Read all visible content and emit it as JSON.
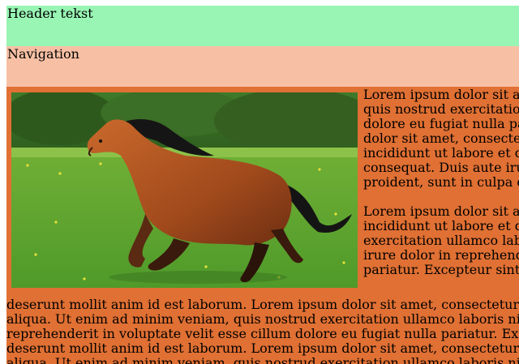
{
  "header": {
    "text": "Header tekst"
  },
  "navigation": {
    "text": "Navigation"
  },
  "main": {
    "image_alt": "horse-photo",
    "side_paragraph_1": [
      "Lorem ipsum dolor sit amet, c",
      "quis nostrud exercitation ullan",
      "dolore eu fugiat nulla pariatur.",
      "dolor sit amet, consectetur adi",
      "incididunt ut labore et dolore r",
      "consequat. Duis aute irure dolo",
      "proident, sunt in culpa qui offi"
    ],
    "side_paragraph_2": [
      "Lorem ipsum dolor sit amet, c",
      "incididunt ut labore et dolore r",
      "exercitation ullamco laboris ni",
      "irure dolor in reprehenderit in",
      "pariatur. Excepteur sint occaec"
    ],
    "bottom_lines": [
      "deserunt mollit anim id est laborum. Lorem ipsum dolor sit amet, consectetur adipiscing elit, sed do",
      "aliqua. Ut enim ad minim veniam, quis nostrud exercitation ullamco laboris nisi ut aliquip ex ea co",
      "reprehenderit in voluptate velit esse cillum dolore eu fugiat nulla pariatur. Excepteur sint occaecat c",
      "deserunt mollit anim id est laborum. Lorem ipsum dolor sit amet, consectetur adipiscing elit, sed do",
      "aliqua. Ut enim ad minim veniam, quis nostrud exercitation ullamco laboris nisi ut aliquip ex ea co"
    ]
  },
  "colors": {
    "header_bg": "#98f5b3",
    "nav_bg": "#f7c0a4",
    "main_bg": "#e07033"
  }
}
